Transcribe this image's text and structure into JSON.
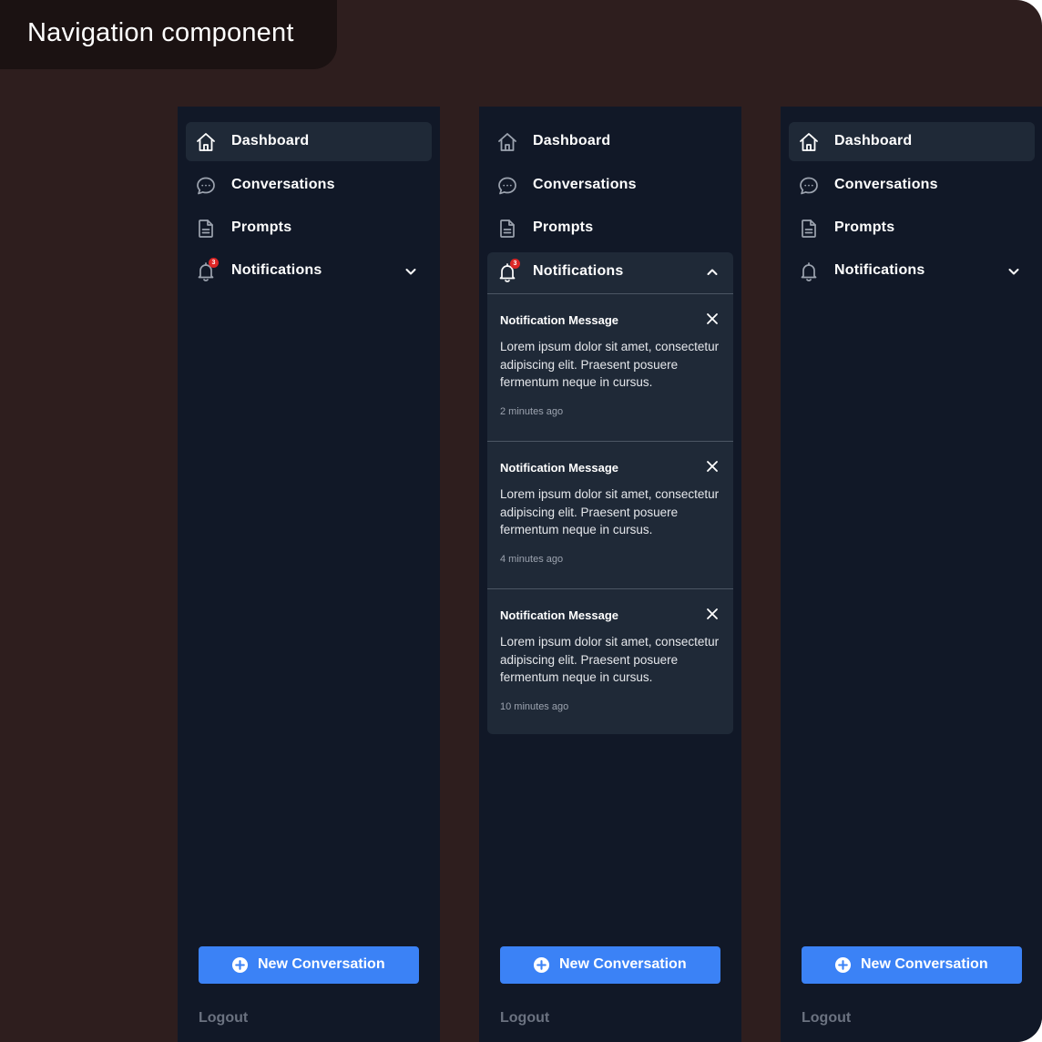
{
  "frame": {
    "title": "Navigation component"
  },
  "nav": {
    "dashboard": "Dashboard",
    "conversations": "Conversations",
    "prompts": "Prompts",
    "notifications": "Notifications"
  },
  "badge_count": "3",
  "notifications": [
    {
      "title": "Notification Message",
      "body": "Lorem ipsum dolor sit amet, consectetur adipiscing elit. Praesent posuere fermentum neque in cursus.",
      "time": "2 minutes ago"
    },
    {
      "title": "Notification Message",
      "body": "Lorem ipsum dolor sit amet, consectetur adipiscing elit. Praesent posuere fermentum neque in cursus.",
      "time": "4 minutes ago"
    },
    {
      "title": "Notification Message",
      "body": "Lorem ipsum dolor sit amet, consectetur adipiscing elit. Praesent posuere fermentum neque in cursus.",
      "time": "10 minutes ago"
    }
  ],
  "new_conversation_label": "New Conversation",
  "logout_label": "Logout",
  "icons": {
    "dashboard": "home-icon",
    "conversations": "chat-bubble-icon",
    "prompts": "document-icon",
    "notifications": "bell-icon",
    "expand": "chevron-down-icon",
    "collapse": "chevron-up-icon",
    "close": "close-icon",
    "add": "plus-circle-icon"
  },
  "colors": {
    "page_background": "#2e1e1e",
    "panel_background": "#111827",
    "active_item": "#1f2937",
    "primary_button": "#3b82f6",
    "badge": "#dc2626",
    "muted_text": "#6b7280"
  }
}
